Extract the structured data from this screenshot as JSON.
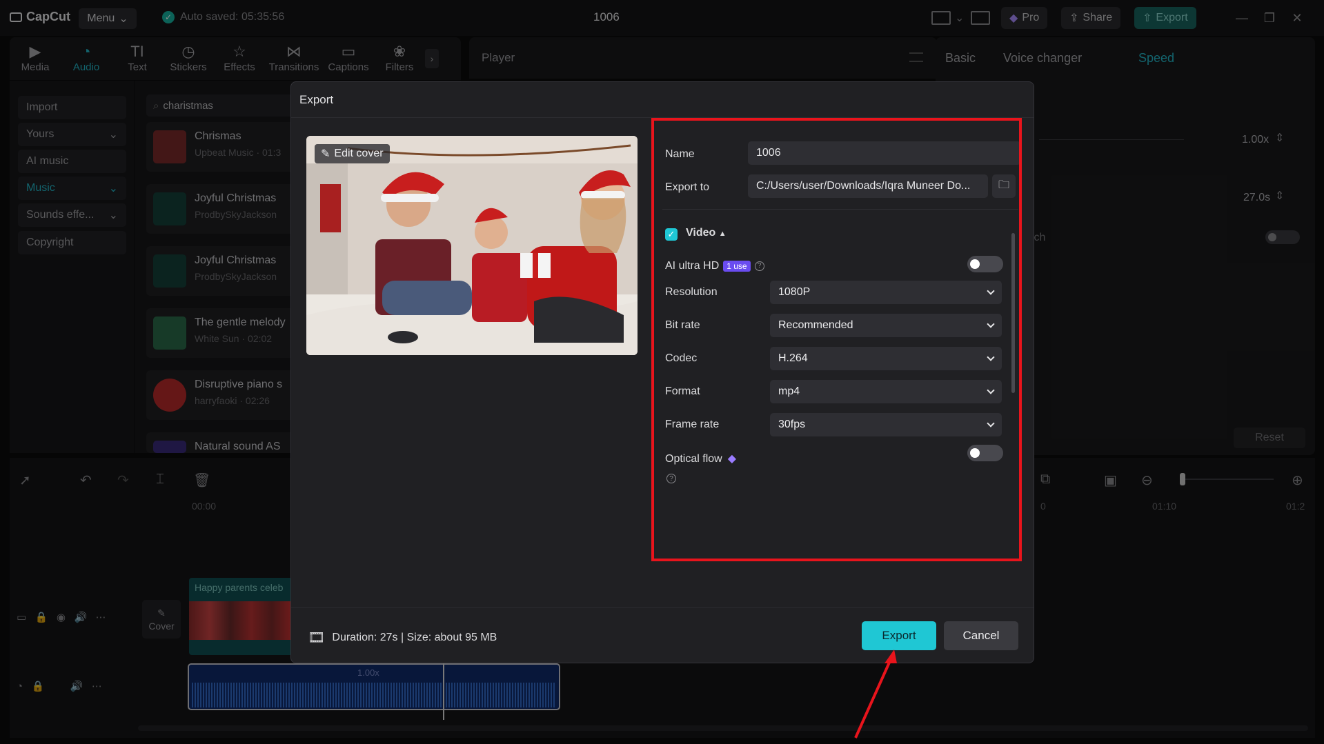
{
  "app": {
    "logo": "CapCut",
    "menu_label": "Menu",
    "autosave": "Auto saved: 05:35:56",
    "project_title": "1006",
    "pro_label": "Pro",
    "share_label": "Share",
    "export_label": "Export"
  },
  "toolbar": {
    "items": [
      {
        "label": "Media",
        "icon": "media-icon"
      },
      {
        "label": "Audio",
        "icon": "audio-icon",
        "active": true
      },
      {
        "label": "Text",
        "icon": "text-icon"
      },
      {
        "label": "Stickers",
        "icon": "stickers-icon"
      },
      {
        "label": "Effects",
        "icon": "effects-icon"
      },
      {
        "label": "Transitions",
        "icon": "transitions-icon"
      },
      {
        "label": "Captions",
        "icon": "captions-icon"
      },
      {
        "label": "Filters",
        "icon": "filters-icon"
      }
    ]
  },
  "left_panel": {
    "categories": [
      {
        "label": "Import",
        "dropdown": false
      },
      {
        "label": "Yours",
        "dropdown": true
      },
      {
        "label": "AI music",
        "dropdown": false
      },
      {
        "label": "Music",
        "dropdown": true,
        "active": true
      },
      {
        "label": "Sounds effe...",
        "dropdown": true
      },
      {
        "label": "Copyright",
        "dropdown": false
      }
    ],
    "search_value": "charistmas",
    "tracks": [
      {
        "title": "Chrismas",
        "subtitle": "Upbeat Music · 01:3",
        "color": "#7a2a2a"
      },
      {
        "title": "Joyful Christmas",
        "subtitle": "ProdbySkyJackson",
        "color": "#14403a"
      },
      {
        "title": "Joyful Christmas",
        "subtitle": "ProdbySkyJackson",
        "color": "#14403a"
      },
      {
        "title": "The gentle melody",
        "subtitle": "White Sun · 02:02",
        "color": "#2a6a4a"
      },
      {
        "title": "Disruptive piano s",
        "subtitle": "harryfaoki · 02:26",
        "color": "#b82a2a"
      },
      {
        "title": "Natural sound AS",
        "subtitle": "",
        "color": "#3a2a7a"
      }
    ]
  },
  "player": {
    "label": "Player"
  },
  "right_panel": {
    "tabs": [
      "Basic",
      "Voice changer",
      "Speed"
    ],
    "active_tab": "Speed",
    "speed_value": "1.00x",
    "duration_value": "27.0s",
    "partial_label": "tch",
    "reset_label": "Reset"
  },
  "timeline": {
    "time_start": "00:00",
    "time_mid": "0",
    "time_b": "01:10",
    "time_c": "01:2",
    "video_clip_label": "Happy parents celeb",
    "cover_label": "Cover",
    "audio_speed": "1.00x"
  },
  "dialog": {
    "title": "Export",
    "edit_cover": "Edit cover",
    "name_label": "Name",
    "name_value": "1006",
    "export_to_label": "Export to",
    "export_to_value": "C:/Users/user/Downloads/Iqra Muneer Do...",
    "video_section": "Video",
    "ai_ultra_hd": "AI ultra HD",
    "ai_badge": "1 use",
    "resolution_label": "Resolution",
    "resolution_value": "1080P",
    "bitrate_label": "Bit rate",
    "bitrate_value": "Recommended",
    "codec_label": "Codec",
    "codec_value": "H.264",
    "format_label": "Format",
    "format_value": "mp4",
    "framerate_label": "Frame rate",
    "framerate_value": "30fps",
    "optical_flow_label": "Optical flow",
    "ai_ultra_hd_on": false,
    "optical_flow_on": false,
    "duration_text": "Duration: 27s | Size: about 95 MB",
    "export_button": "Export",
    "cancel_button": "Cancel"
  },
  "colors": {
    "accent": "#1fc7d4",
    "highlight_box": "#e8141c",
    "annotation_arrow": "#e8141c"
  }
}
